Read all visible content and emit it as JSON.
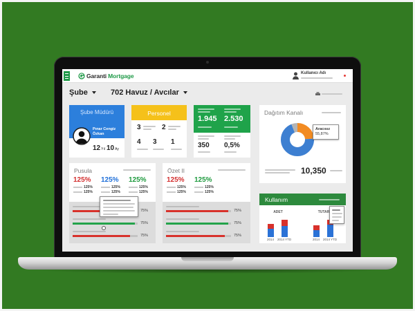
{
  "colors": {
    "background": "#327a22",
    "brand_green": "#1f9a48",
    "manager_blue": "#2c7fdc",
    "personnel_yellow": "#f5c11a",
    "kpi_green": "#1fa34a",
    "usage_green": "#2d8a3d",
    "red": "#d8312b",
    "blue": "#2b72d6",
    "green": "#1f9a3e",
    "notification": "#e53935"
  },
  "icons": {
    "menu": "hamburger-icon",
    "logo": "garanti-logo-icon",
    "user": "user-icon",
    "dropdown": "chevron-down-icon",
    "print": "print-icon",
    "avatar": "person-avatar-icon"
  },
  "header": {
    "logo_brand": "Garanti",
    "logo_product": "Mortgage",
    "user_name": "Kullanıcı Adı"
  },
  "filters": {
    "branch_label": "Şube",
    "branch_value": "702 Havuz / Avcılar"
  },
  "manager_card": {
    "title": "Şube Müdürü",
    "name": "Pınar Cengiz Özkan",
    "years": "12",
    "years_unit": "Yıl",
    "months": "10",
    "months_unit": "Ay"
  },
  "personnel_card": {
    "title": "Personel",
    "counts": [
      "3",
      "2",
      "4",
      "3",
      "1"
    ]
  },
  "green_card": {
    "top": [
      "1.945",
      "2.530"
    ],
    "bottom": [
      "350",
      "0,5%"
    ]
  },
  "distribution_card": {
    "title": "Dağıtım Kanalı",
    "tooltip_label": "Aracısız",
    "tooltip_value": "55,87%",
    "total": "10,350",
    "slices": [
      {
        "color": "#f28b22",
        "share": 0.24
      },
      {
        "color": "#3d7fd1",
        "share": 0.7
      },
      {
        "color": "#b4b4b4",
        "share": 0.06
      }
    ]
  },
  "pusula_card": {
    "title": "Pusula",
    "kpis": [
      {
        "value": "125%",
        "color": "#d32f2f",
        "sub": [
          "125%",
          "125%"
        ]
      },
      {
        "value": "125%",
        "color": "#1e6fd9",
        "sub": [
          "125%",
          "125%"
        ]
      },
      {
        "value": "125%",
        "color": "#1e9a3e",
        "sub": [
          "125%",
          "125%"
        ]
      }
    ],
    "bars": [
      {
        "value": "75%",
        "fill": 0.96,
        "color": "#d8312b"
      },
      {
        "value": "75%",
        "fill": 0.96,
        "color": "#23a34a"
      },
      {
        "value": "75%",
        "fill": 0.88,
        "color": "#d8312b"
      }
    ]
  },
  "ozet_card": {
    "title": "Özet II",
    "kpis": [
      {
        "value": "125%",
        "color": "#d32f2f",
        "sub": [
          "125%",
          "125%"
        ]
      },
      {
        "value": "125%",
        "color": "#1e9a3e",
        "sub": [
          "125%",
          "125%"
        ]
      }
    ],
    "bars": [
      {
        "value": "75%",
        "fill": 0.96,
        "color": "#d8312b"
      },
      {
        "value": "75%",
        "fill": 0.96,
        "color": "#23a34a"
      },
      {
        "value": "75%",
        "fill": 0.9,
        "color": "#d8312b"
      }
    ]
  },
  "usage_card": {
    "title": "Kullanım",
    "groups": [
      {
        "label": "ADET",
        "bars": [
          {
            "label": "2014",
            "blue": 0.4,
            "red": 0.25
          },
          {
            "label": "2014 YTD",
            "blue": 0.55,
            "red": 0.27
          }
        ]
      },
      {
        "label": "TUTAR",
        "bars": [
          {
            "label": "2014",
            "blue": 0.35,
            "red": 0.22
          },
          {
            "label": "2014 YTD",
            "blue": 0.6,
            "red": 0.25
          }
        ]
      }
    ]
  }
}
